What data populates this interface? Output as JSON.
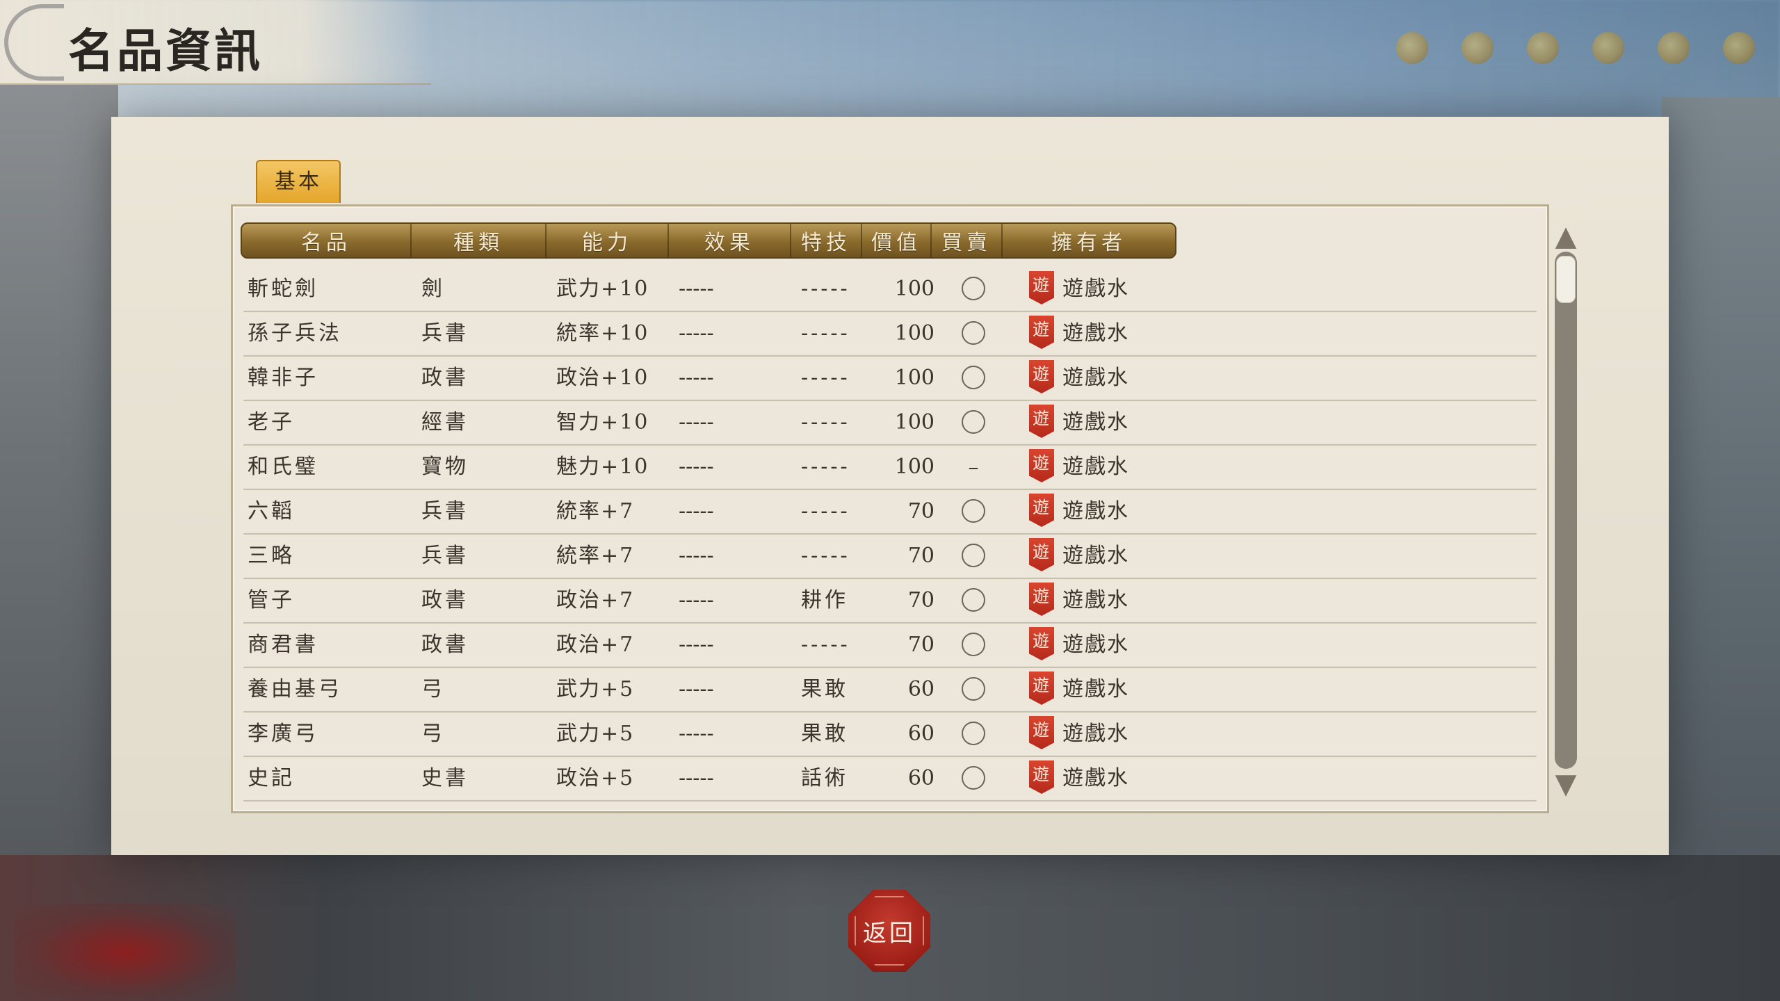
{
  "title": "名品資訊",
  "tabs": [
    {
      "label": "基本",
      "active": true
    }
  ],
  "table": {
    "headers": [
      "名品",
      "種類",
      "能力",
      "效果",
      "特技",
      "價值",
      "買賣",
      "擁有者"
    ],
    "rows": [
      {
        "name": "斬蛇劍",
        "type": "劍",
        "ability": "武力+10",
        "effect": "-----",
        "skill": "-----",
        "value": "100",
        "trade": "circle",
        "owner_badge": "遊",
        "owner": "遊戲水"
      },
      {
        "name": "孫子兵法",
        "type": "兵書",
        "ability": "統率+10",
        "effect": "-----",
        "skill": "-----",
        "value": "100",
        "trade": "circle",
        "owner_badge": "遊",
        "owner": "遊戲水"
      },
      {
        "name": "韓非子",
        "type": "政書",
        "ability": "政治+10",
        "effect": "-----",
        "skill": "-----",
        "value": "100",
        "trade": "circle",
        "owner_badge": "遊",
        "owner": "遊戲水"
      },
      {
        "name": "老子",
        "type": "經書",
        "ability": "智力+10",
        "effect": "-----",
        "skill": "-----",
        "value": "100",
        "trade": "circle",
        "owner_badge": "遊",
        "owner": "遊戲水"
      },
      {
        "name": "和氏璧",
        "type": "寶物",
        "ability": "魅力+10",
        "effect": "-----",
        "skill": "-----",
        "value": "100",
        "trade": "–",
        "owner_badge": "遊",
        "owner": "遊戲水"
      },
      {
        "name": "六韜",
        "type": "兵書",
        "ability": "統率+7",
        "effect": "-----",
        "skill": "-----",
        "value": "70",
        "trade": "circle",
        "owner_badge": "遊",
        "owner": "遊戲水"
      },
      {
        "name": "三略",
        "type": "兵書",
        "ability": "統率+7",
        "effect": "-----",
        "skill": "-----",
        "value": "70",
        "trade": "circle",
        "owner_badge": "遊",
        "owner": "遊戲水"
      },
      {
        "name": "管子",
        "type": "政書",
        "ability": "政治+7",
        "effect": "-----",
        "skill": "耕作",
        "value": "70",
        "trade": "circle",
        "owner_badge": "遊",
        "owner": "遊戲水"
      },
      {
        "name": "商君書",
        "type": "政書",
        "ability": "政治+7",
        "effect": "-----",
        "skill": "-----",
        "value": "70",
        "trade": "circle",
        "owner_badge": "遊",
        "owner": "遊戲水"
      },
      {
        "name": "養由基弓",
        "type": "弓",
        "ability": "武力+5",
        "effect": "-----",
        "skill": "果敢",
        "value": "60",
        "trade": "circle",
        "owner_badge": "遊",
        "owner": "遊戲水"
      },
      {
        "name": "李廣弓",
        "type": "弓",
        "ability": "武力+5",
        "effect": "-----",
        "skill": "果敢",
        "value": "60",
        "trade": "circle",
        "owner_badge": "遊",
        "owner": "遊戲水"
      },
      {
        "name": "史記",
        "type": "史書",
        "ability": "政治+5",
        "effect": "-----",
        "skill": "話術",
        "value": "60",
        "trade": "circle",
        "owner_badge": "遊",
        "owner": "遊戲水"
      }
    ]
  },
  "scrollbar": {
    "up_icon": "▲",
    "down_icon": "▼"
  },
  "footer": {
    "back_label": "返回"
  },
  "colors": {
    "owner_badge": "#c0321f",
    "header_gold": "#8a6a2c",
    "tab_gold": "#e4a52a",
    "back_red": "#9c1e16"
  }
}
